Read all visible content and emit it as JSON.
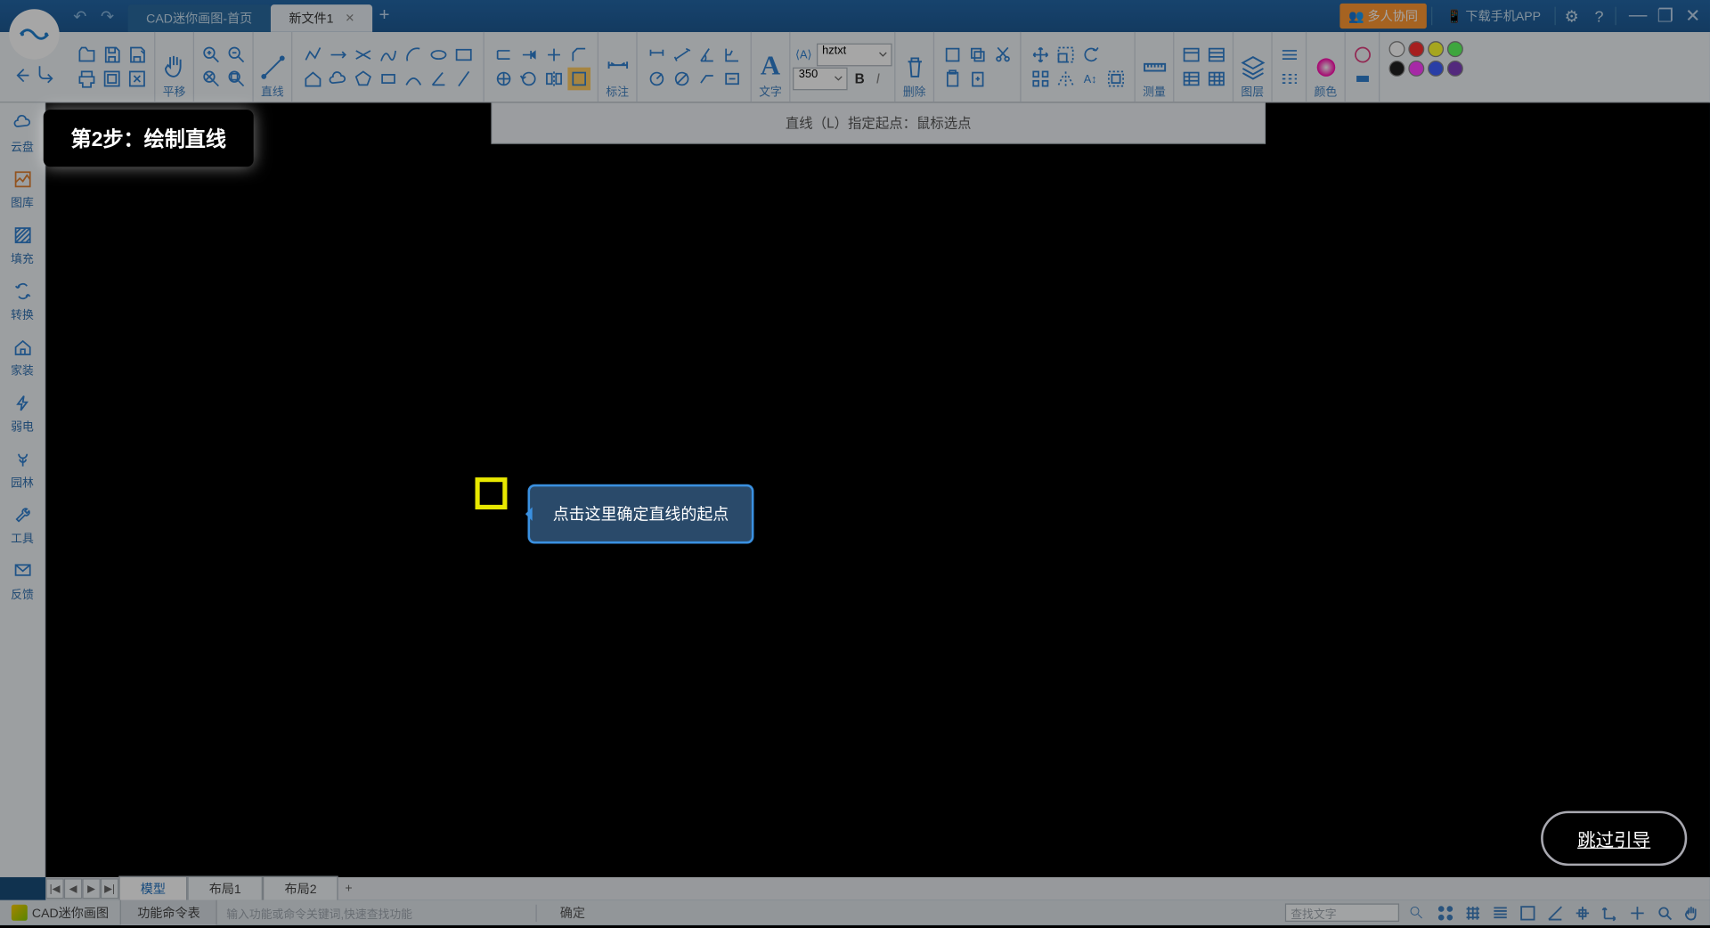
{
  "titlebar": {
    "undo_title": "撤销",
    "redo_title": "重做",
    "tabs": [
      {
        "label": "CAD迷你画图-首页",
        "active": false
      },
      {
        "label": "新文件1",
        "active": true
      }
    ],
    "collab": "多人协同",
    "download_app": "下载手机APP",
    "settings_title": "设置",
    "help_title": "帮助",
    "min_title": "最小化",
    "max_title": "还原",
    "close_title": "关闭"
  },
  "ribbon": {
    "groups": {
      "nav": {
        "back": "后退",
        "fwd": "前进"
      },
      "file": {
        "open": "打开",
        "save": "保存",
        "redo2": "重做"
      },
      "print": {
        "print": "打印",
        "preview": "预览",
        "export": "导出"
      },
      "pan": {
        "label": "平移"
      },
      "zoom": {
        "in": "放大",
        "out": "缩小",
        "ext": "范围",
        "win": "窗口"
      },
      "line": {
        "label": "直线"
      },
      "draw_row1": [
        "polyline",
        "ray",
        "xline",
        "spline",
        "arc",
        "ellipse",
        "rect"
      ],
      "draw_row2": [
        "home",
        "cloud",
        "polygon",
        "rectangle",
        "curve",
        "angle",
        "slash"
      ],
      "edit_row1": [
        "offset",
        "extend",
        "trim",
        "chamfer"
      ],
      "edit_row2": [
        "circle-edit",
        "rotate",
        "mirror",
        "block"
      ],
      "annot": {
        "label": "标注"
      },
      "annot_row1": [
        "linear",
        "aligned",
        "angular",
        "ordinate"
      ],
      "annot_row2": [
        "radius",
        "diameter",
        "leader",
        "edit-dim"
      ],
      "text": {
        "label": "文字",
        "bigA": "A"
      },
      "font": {
        "symbol": "⟨A⟩",
        "name": "hztxt",
        "size": "350",
        "bold": "B",
        "italic": "I"
      },
      "del": {
        "label": "删除"
      },
      "del_row1": [
        "erase",
        "copy",
        "cut"
      ],
      "del_row2": [
        "paste",
        "paste-block"
      ],
      "mod_row1": [
        "move",
        "scale",
        "rotate2"
      ],
      "mod_row2": [
        "array",
        "mirror2",
        "stretch",
        "group"
      ],
      "measure": {
        "label": "测量"
      },
      "measure_row1": [
        "dist",
        "area"
      ],
      "measure_row2": [
        "list",
        "table"
      ],
      "layer": {
        "label": "图层"
      },
      "props_row1": [
        "props1"
      ],
      "props_row2": [
        "props2"
      ],
      "color": {
        "label": "颜色"
      },
      "color_row1": [
        "linetype"
      ],
      "color_row2": [
        "lineweight"
      ],
      "palette": {
        "row1": [
          "#ffffff",
          "#ff3030",
          "#ffff30",
          "#60ff60"
        ],
        "row2": [
          "#202020",
          "#ff40ff",
          "#4060ff",
          "#8040c0"
        ]
      }
    }
  },
  "sidebar": [
    {
      "id": "cloud",
      "label": "云盘"
    },
    {
      "id": "gallery",
      "label": "图库"
    },
    {
      "id": "hatch",
      "label": "填充"
    },
    {
      "id": "convert",
      "label": "转换"
    },
    {
      "id": "home",
      "label": "家装"
    },
    {
      "id": "elec",
      "label": "弱电"
    },
    {
      "id": "garden",
      "label": "园林"
    },
    {
      "id": "tools",
      "label": "工具"
    },
    {
      "id": "feedback",
      "label": "反馈"
    }
  ],
  "command_hint": "直线（L）指定起点：鼠标选点",
  "tutorial": {
    "step_title": "第2步：绘制直线",
    "tooltip": "点击这里确定直线的起点",
    "skip": "跳过引导"
  },
  "layout_tabs": {
    "nav": [
      "|◀",
      "◀",
      "▶",
      "▶|"
    ],
    "items": [
      "模型",
      "布局1",
      "布局2"
    ],
    "active_index": 0,
    "plus": "+"
  },
  "statusbar": {
    "appname": "CAD迷你画图",
    "func_list": "功能命令表",
    "cmd_placeholder": "输入功能或命令关键词,快速查找功能",
    "confirm": "确定",
    "search_placeholder": "查找文字",
    "right_tools": [
      "snap",
      "grid1",
      "grid2",
      "ortho",
      "polar",
      "osnap",
      "axis",
      "plus",
      "fit",
      "pan-hand"
    ]
  }
}
